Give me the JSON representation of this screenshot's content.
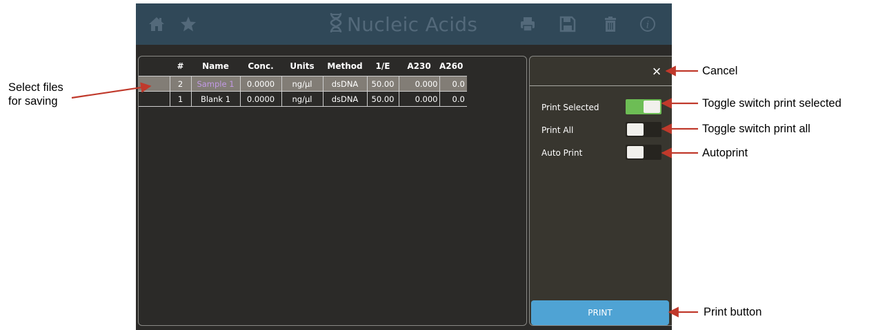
{
  "app": {
    "title": "Nucleic Acids",
    "topbar_icons": [
      "home-icon",
      "star-icon",
      "dna-icon",
      "print-icon",
      "save-icon",
      "trash-icon",
      "info-icon"
    ],
    "colors": {
      "topbar": "#304858",
      "background": "#2b2a28",
      "selected_row": "#827d76",
      "selected_name": "#c39ae6",
      "toggle_on": "#6dbd55",
      "print_button": "#4fa3d4",
      "arrow": "#c0392b"
    }
  },
  "table": {
    "headers": [
      "",
      "#",
      "Name",
      "Conc.",
      "Units",
      "Method",
      "1/E",
      "A230",
      "A260"
    ],
    "rows": [
      {
        "selected": true,
        "num": "2",
        "name": "Sample 1",
        "conc": "0.0000",
        "units": "ng/µl",
        "method": "dsDNA",
        "inv_e": "50.00",
        "a230": "0.000",
        "a260": "0.0"
      },
      {
        "selected": false,
        "num": "1",
        "name": "Blank 1",
        "conc": "0.0000",
        "units": "ng/µl",
        "method": "dsDNA",
        "inv_e": "50.00",
        "a230": "0.000",
        "a260": "0.0"
      }
    ]
  },
  "print_panel": {
    "cancel_symbol": "×",
    "options": [
      {
        "label": "Print Selected",
        "on": true
      },
      {
        "label": "Print All",
        "on": false
      },
      {
        "label": "Auto Print",
        "on": false
      }
    ],
    "print_button_label": "PRINT"
  },
  "annotations": {
    "select_files": "Select files\nfor saving",
    "cancel": "Cancel",
    "toggle_print_selected": "Toggle switch print selected",
    "toggle_print_all": "Toggle switch print all",
    "autoprint": "Autoprint",
    "print_button": "Print button"
  }
}
